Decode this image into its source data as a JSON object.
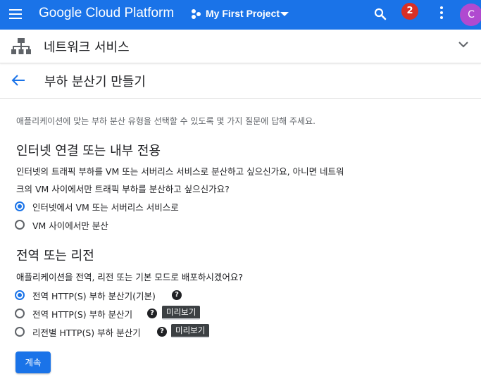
{
  "topbar": {
    "brand": "Google Cloud Platform",
    "project_label": "My First Project",
    "notification_count": "2",
    "avatar_letter": "C",
    "color": "#1a73e8"
  },
  "section": {
    "title": "네트워크 서비스"
  },
  "page": {
    "title": "부하 분산기 만들기",
    "intro": "애플리케이션에 맞는 부하 분산 유형을 선택할 수 있도록 몇 가지 질문에 답해 주세요."
  },
  "q1": {
    "heading": "인터넷 연결 또는 내부 전용",
    "text_line1": "인터넷의 트래픽 부하를 VM 또는 서버리스 서비스로 분산하고 싶으신가요, 아니면 네트워",
    "text_line2": "크의 VM 사이에서만 트래픽 부하를 분산하고 싶으신가요?",
    "options": [
      {
        "label": "인터넷에서 VM 또는 서버리스 서비스로",
        "selected": true
      },
      {
        "label": "VM 사이에서만 분산",
        "selected": false
      }
    ]
  },
  "q2": {
    "heading": "전역 또는 리전",
    "text": "애플리케이션을 전역, 리전 또는 기본 모드로 배포하시겠어요?",
    "options": [
      {
        "label": "전역 HTTP(S) 부하 분산기(기본)",
        "selected": true,
        "help": "?"
      },
      {
        "label": "전역 HTTP(S) 부하 분산기",
        "selected": false,
        "help": "?",
        "badge": "미리보기"
      },
      {
        "label": "리전별 HTTP(S) 부하 분산기",
        "selected": false,
        "help": "?",
        "badge": "미리보기"
      }
    ]
  },
  "actions": {
    "continue_label": "계속"
  }
}
